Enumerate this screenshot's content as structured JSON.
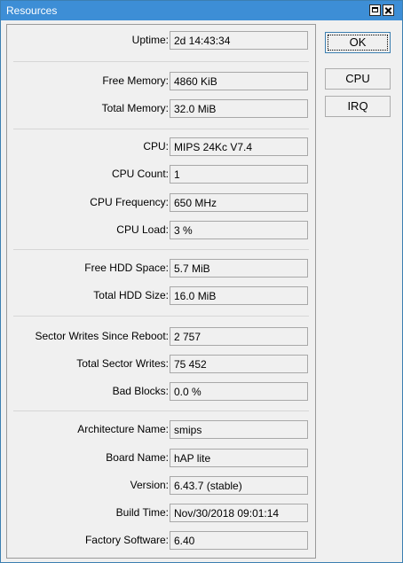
{
  "window": {
    "title": "Resources"
  },
  "buttons": {
    "ok": "OK",
    "cpu": "CPU",
    "irq": "IRQ"
  },
  "fields": [
    {
      "label": "Uptime:",
      "value": "2d 14:43:34"
    },
    {
      "label": "Free Memory:",
      "value": "4860 KiB"
    },
    {
      "label": "Total Memory:",
      "value": "32.0 MiB"
    },
    {
      "label": "CPU:",
      "value": "MIPS 24Kc V7.4"
    },
    {
      "label": "CPU Count:",
      "value": "1"
    },
    {
      "label": "CPU Frequency:",
      "value": "650 MHz"
    },
    {
      "label": "CPU Load:",
      "value": "3 %"
    },
    {
      "label": "Free HDD Space:",
      "value": "5.7 MiB"
    },
    {
      "label": "Total HDD Size:",
      "value": "16.0 MiB"
    },
    {
      "label": "Sector Writes Since Reboot:",
      "value": "2 757"
    },
    {
      "label": "Total Sector Writes:",
      "value": "75 452"
    },
    {
      "label": "Bad Blocks:",
      "value": "0.0 %"
    },
    {
      "label": "Architecture Name:",
      "value": "smips"
    },
    {
      "label": "Board Name:",
      "value": "hAP lite"
    },
    {
      "label": "Version:",
      "value": "6.43.7 (stable)"
    },
    {
      "label": "Build Time:",
      "value": "Nov/30/2018 09:01:14"
    },
    {
      "label": "Factory Software:",
      "value": "6.40"
    }
  ]
}
